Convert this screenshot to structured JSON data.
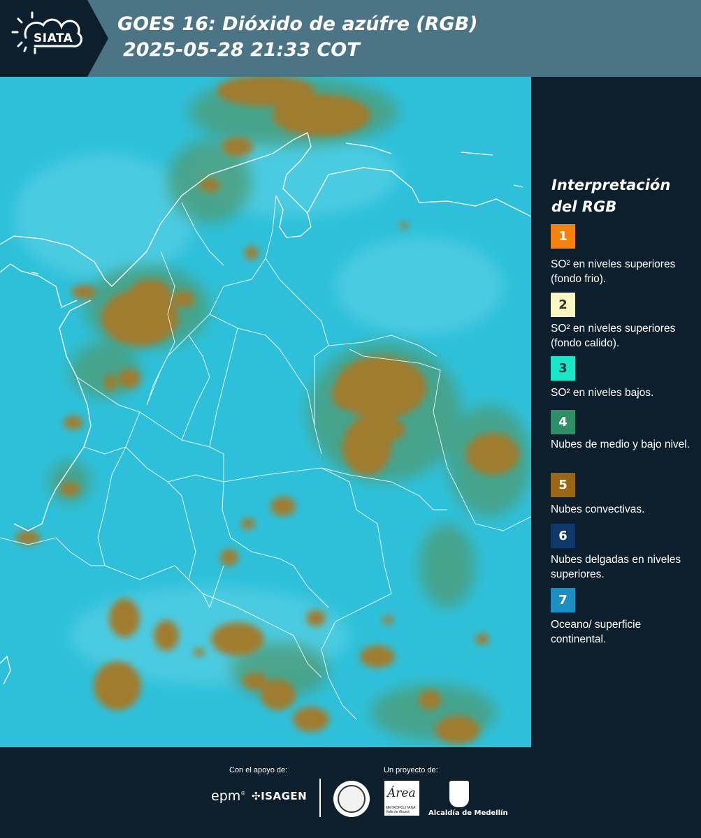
{
  "header": {
    "logo_text": "SIATA",
    "title_line1": "GOES 16: Dióxido de azúfre (RGB)",
    "title_line2": "2025-05-28 21:33 COT"
  },
  "legend": {
    "title_line1": "Interpretación",
    "title_line2": "del RGB",
    "items": [
      {
        "number": "1",
        "color": "#f5820f",
        "text_color": "#ffffff",
        "label": "SO² en niveles superiores (fondo frio)."
      },
      {
        "number": "2",
        "color": "#fdf6c3",
        "text_color": "#333333",
        "label": "SO² en niveles superiores (fondo calido)."
      },
      {
        "number": "3",
        "color": "#19e6c8",
        "text_color": "#0d3b3b",
        "label": "SO² en niveles bajos."
      },
      {
        "number": "4",
        "color": "#2e8f66",
        "text_color": "#ffffff",
        "label": "Nubes de medio y bajo nivel."
      },
      {
        "number": "5",
        "color": "#9a6514",
        "text_color": "#ffffff",
        "label": "Nubes convectivas."
      },
      {
        "number": "6",
        "color": "#10386a",
        "text_color": "#ffffff",
        "label": "Nubes delgadas en niveles superiores."
      },
      {
        "number": "7",
        "color": "#1a8fc0",
        "text_color": "#ffffff",
        "label": "Oceano/ superficie continental."
      }
    ]
  },
  "map": {
    "background_color": "#2ec0da",
    "convective_color": "#a07c2e",
    "midlevel_color": "#5a9a6a"
  },
  "footer": {
    "support_label": "Con el apoyo de:",
    "project_label": "Un proyecto de:",
    "epm": "epm",
    "isagen": "ISAGEN",
    "area_logo": "Área",
    "area_sub": "METROPOLITANA Valle de Aburrá",
    "alcaldia": "Alcaldía de Medellín"
  }
}
